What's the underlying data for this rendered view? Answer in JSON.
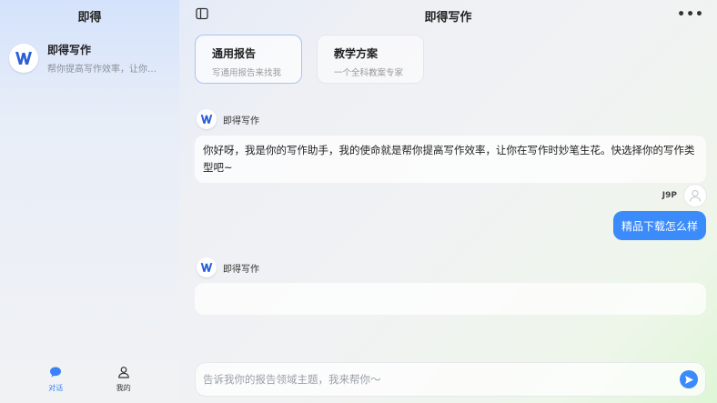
{
  "sidebar": {
    "title": "即得",
    "conversations": [
      {
        "name": "即得写作",
        "preview": "帮你提高写作效率，让你…"
      }
    ],
    "nav": [
      {
        "label": "对话",
        "icon": "chat-bubble-icon",
        "active": true
      },
      {
        "label": "我的",
        "icon": "user-icon",
        "active": false
      }
    ]
  },
  "header": {
    "title": "即得写作"
  },
  "cards": [
    {
      "title": "通用报告",
      "desc": "写通用报告来找我",
      "selected": true
    },
    {
      "title": "教学方案",
      "desc": "一个全科教案专家",
      "selected": false
    }
  ],
  "messages": {
    "bot_name": "即得写作",
    "bot_1": "你好呀，我是你的写作助手，我的使命就是帮你提高写作效率，让你在写作时妙笔生花。快选择你的写作类型吧~",
    "user_name": "J9P",
    "user_1": "精品下载怎么样",
    "bot_2": ""
  },
  "input": {
    "placeholder": "告诉我你的报告领域主题，我来帮你～"
  },
  "colors": {
    "accent": "#3b8bfa",
    "w_logo": "#2b5fd8"
  }
}
